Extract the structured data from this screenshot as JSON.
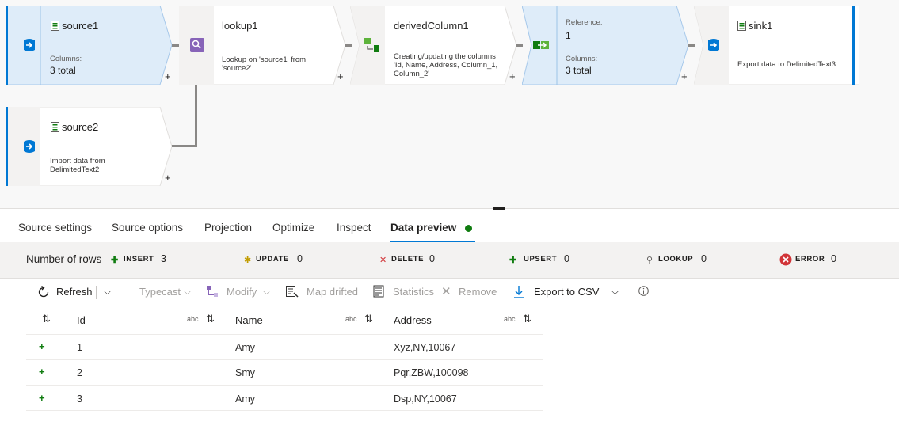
{
  "pipeline": {
    "source1": {
      "title": "source1",
      "columns_label": "Columns:",
      "columns_value": "3 total"
    },
    "lookup1": {
      "title": "lookup1",
      "desc_line1": "Lookup on 'source1' from",
      "desc_line2": "'source2'"
    },
    "derived": {
      "title": "derivedColumn1",
      "desc_line1": "Creating/updating the columns",
      "desc_line2": "'Id, Name, Address, Column_1,",
      "desc_line3": "Column_2'"
    },
    "reference": {
      "ref_label": "Reference:",
      "ref_value": "1",
      "columns_label": "Columns:",
      "columns_value": "3 total"
    },
    "sink1": {
      "title": "sink1",
      "desc": "Export data to DelimitedText3"
    },
    "source2": {
      "title": "source2",
      "desc_line1": "Import data from",
      "desc_line2": "DelimitedText2"
    },
    "plus": "+"
  },
  "tabs": [
    "Source settings",
    "Source options",
    "Projection",
    "Optimize",
    "Inspect",
    "Data preview"
  ],
  "counts": {
    "title": "Number of rows",
    "insert_label": "INSERT",
    "insert_value": "3",
    "update_label": "UPDATE",
    "update_value": "0",
    "delete_label": "DELETE",
    "delete_value": "0",
    "upsert_label": "UPSERT",
    "upsert_value": "0",
    "lookup_label": "LOOKUP",
    "lookup_value": "0",
    "error_label": "ERROR",
    "error_value": "0"
  },
  "toolbar": {
    "refresh": "Refresh",
    "typecast": "Typecast",
    "modify": "Modify",
    "map_drifted": "Map drifted",
    "statistics": "Statistics",
    "remove": "Remove",
    "export_csv": "Export to CSV"
  },
  "grid": {
    "columns": [
      {
        "name": "Id",
        "type": "abc"
      },
      {
        "name": "Name",
        "type": "abc"
      },
      {
        "name": "Address",
        "type": "abc"
      }
    ],
    "rows": [
      {
        "Id": "1",
        "Name": "Amy",
        "Address": "Xyz,NY,10067"
      },
      {
        "Id": "2",
        "Name": "Smy",
        "Address": "Pqr,ZBW,100098"
      },
      {
        "Id": "3",
        "Name": "Amy",
        "Address": "Dsp,NY,10067"
      }
    ]
  },
  "colors": {
    "accent": "#0078d4",
    "selected_node": "#deecf9",
    "success": "#107c10",
    "error": "#d13438"
  }
}
